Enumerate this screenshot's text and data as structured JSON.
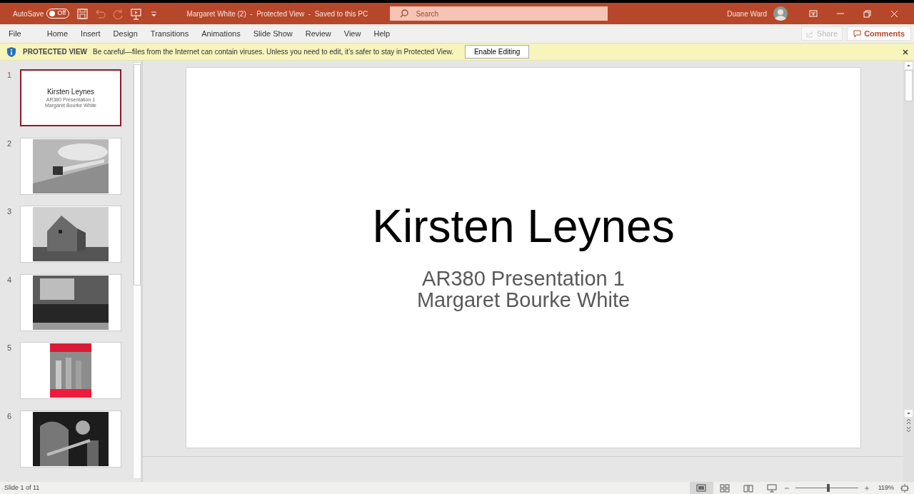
{
  "title_bar": {
    "autosave_label": "AutoSave",
    "autosave": {
      "label": "Off",
      "on": false
    },
    "quick_access": [
      {
        "kind": "save",
        "disabled": false
      },
      {
        "kind": "undo",
        "disabled": true
      },
      {
        "kind": "redo",
        "disabled": true
      },
      {
        "kind": "present",
        "disabled": false
      },
      {
        "kind": "customize",
        "disabled": false
      }
    ],
    "document_title": "Margaret White (2)  -  Protected View  -  Saved to this PC",
    "search": {
      "placeholder": "Search"
    },
    "user_name": "Duane Ward"
  },
  "ribbon_tabs": [
    {
      "label": "File",
      "selected": false
    },
    {
      "label": "Home",
      "selected": false
    },
    {
      "label": "Insert",
      "selected": false
    },
    {
      "label": "Design",
      "selected": false
    },
    {
      "label": "Transitions",
      "selected": false
    },
    {
      "label": "Animations",
      "selected": false
    },
    {
      "label": "Slide Show",
      "selected": false
    },
    {
      "label": "Review",
      "selected": false
    },
    {
      "label": "View",
      "selected": false
    },
    {
      "label": "Help",
      "selected": false
    }
  ],
  "share_button": {
    "label": "Share",
    "disabled": true
  },
  "comments_button": {
    "label": "Comments"
  },
  "message_bar": {
    "heading": "PROTECTED VIEW",
    "message": "Be careful—files from the Internet can contain viruses. Unless you need to edit, it’s safer to stay in Protected View.",
    "button": "Enable Editing"
  },
  "slides": [
    {
      "number": "1",
      "selected": true,
      "kind": "title",
      "title": "Kirsten Leynes",
      "subtitle_lines": [
        "AR380 Presentation 1",
        "Margaret Bourke White"
      ]
    },
    {
      "number": "2",
      "selected": false,
      "kind": "picture"
    },
    {
      "number": "3",
      "selected": false,
      "kind": "picture"
    },
    {
      "number": "4",
      "selected": false,
      "kind": "picture"
    },
    {
      "number": "5",
      "selected": false,
      "kind": "picture"
    },
    {
      "number": "6",
      "selected": false,
      "kind": "picture"
    }
  ],
  "slide": {
    "title": "Kirsten Leynes",
    "subtitle_lines": [
      "AR380 Presentation 1",
      "Margaret Bourke White"
    ]
  },
  "status_bar": {
    "slide_info": "Slide 1 of 11",
    "views": [
      {
        "kind": "normal",
        "selected": true
      },
      {
        "kind": "sorter",
        "selected": false
      },
      {
        "kind": "reading",
        "selected": false
      },
      {
        "kind": "slideshow",
        "selected": false
      }
    ],
    "zoom": {
      "level": 0.53,
      "reading": "119%"
    }
  }
}
